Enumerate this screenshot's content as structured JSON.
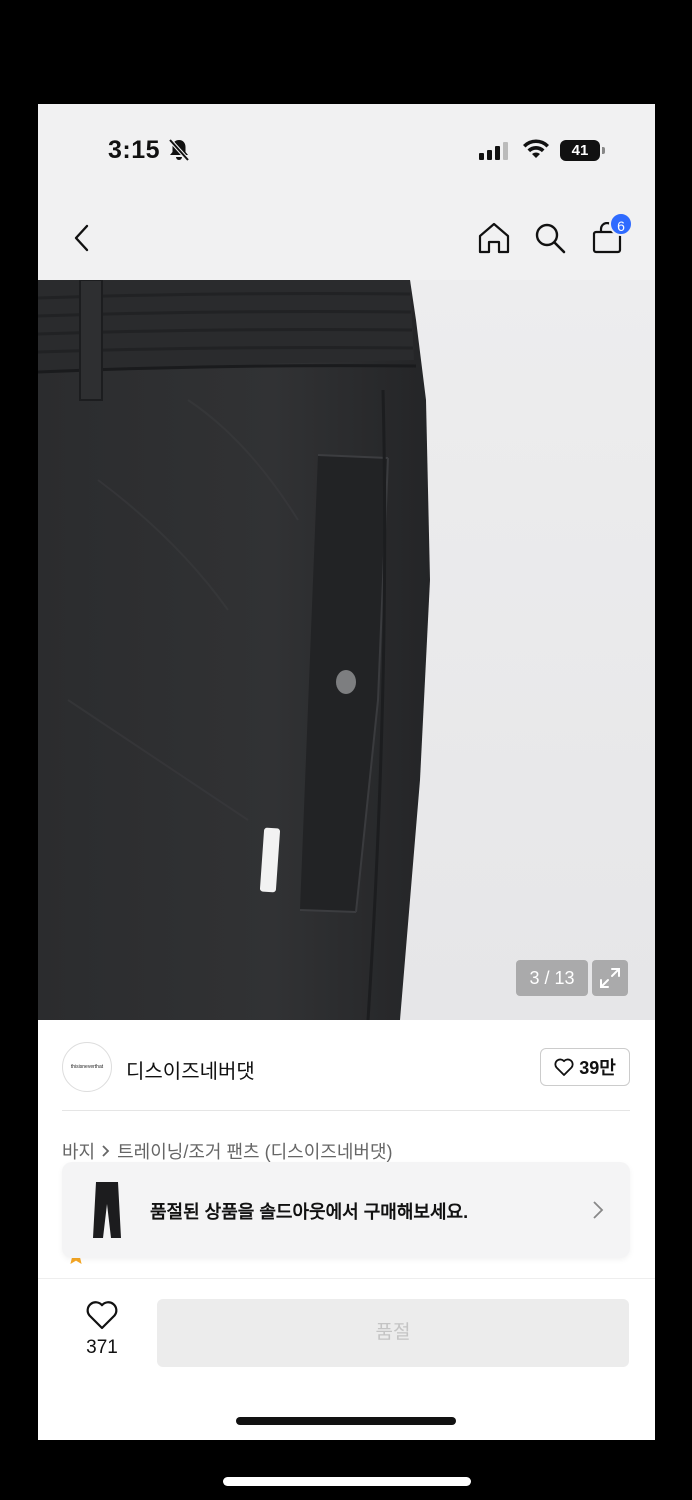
{
  "status_bar": {
    "time": "3:15",
    "battery": "41"
  },
  "nav": {
    "cart_count": "6"
  },
  "gallery": {
    "pager": "3 / 13"
  },
  "brand": {
    "name": "디스이즈네버댓",
    "logo_text": "thisisneverthat",
    "likes": "39만"
  },
  "breadcrumb": {
    "category": "바지",
    "subcategory": "트레이닝/조거 팬츠 (디스이즈네버댓)"
  },
  "toast": {
    "message": "품절된 상품을 솔드아웃에서 구매해보세요."
  },
  "bottom_bar": {
    "wish_count": "371",
    "buy_label": "품절"
  },
  "colors": {
    "accent": "#2f6bff",
    "disabled_bg": "#ececec",
    "disabled_text": "#c4c4c4",
    "rating_star": "#f5a623"
  }
}
